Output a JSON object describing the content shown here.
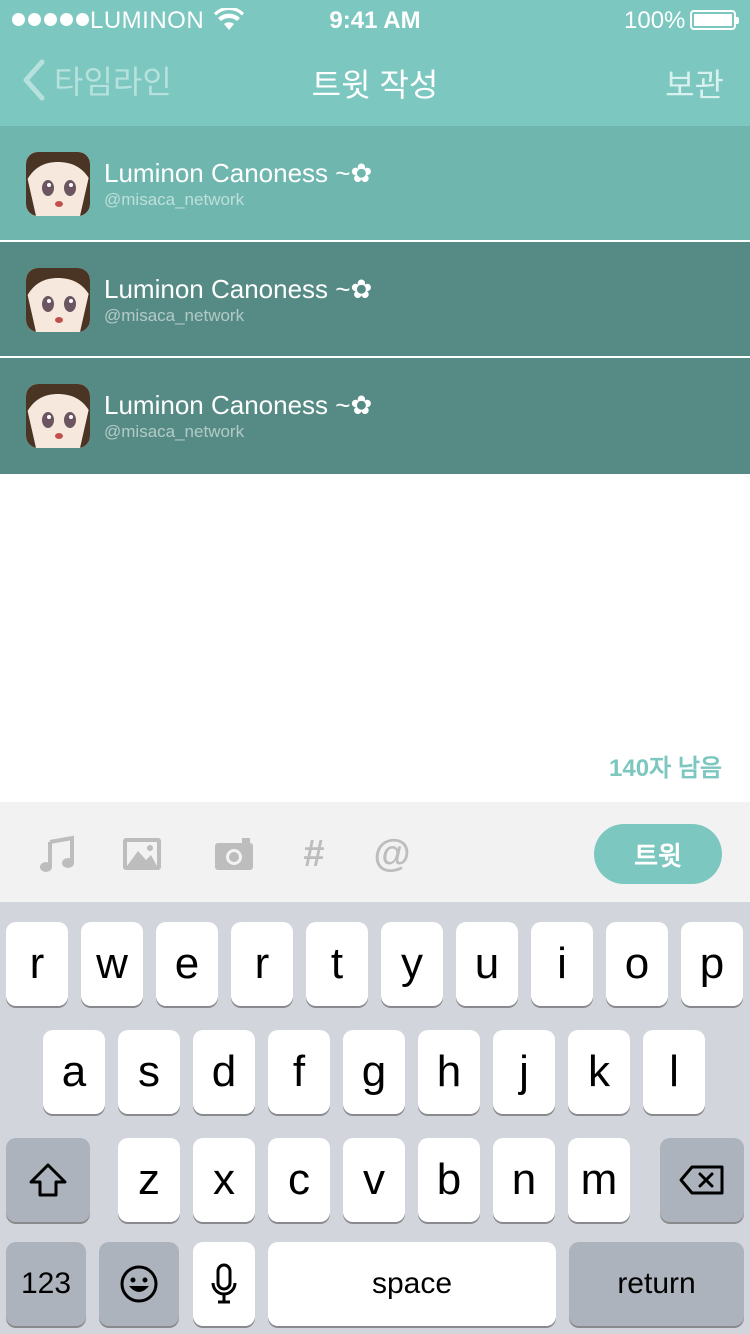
{
  "status_bar": {
    "carrier": "LUMINON",
    "time": "9:41 AM",
    "battery": "100%"
  },
  "nav": {
    "back_label": "타임라인",
    "title": "트윗 작성",
    "save_label": "보관"
  },
  "accounts": [
    {
      "name": "Luminon Canoness ~✿",
      "handle": "@misaca_network",
      "state": "active"
    },
    {
      "name": "Luminon Canoness ~✿",
      "handle": "@misaca_network",
      "state": "inactive"
    },
    {
      "name": "Luminon Canoness ~✿",
      "handle": "@misaca_network",
      "state": "inactive"
    }
  ],
  "compose": {
    "remaining": "140자 남음"
  },
  "toolbar": {
    "icons": [
      "music-icon",
      "image-icon",
      "camera-icon",
      "hashtag-icon",
      "mention-icon"
    ],
    "hashtag": "#",
    "mention": "@",
    "tweet_label": "트윗"
  },
  "keyboard": {
    "row1": [
      "r",
      "w",
      "e",
      "r",
      "t",
      "y",
      "u",
      "i",
      "o",
      "p"
    ],
    "row2": [
      "a",
      "s",
      "d",
      "f",
      "g",
      "h",
      "j",
      "k",
      "l"
    ],
    "row3": [
      "z",
      "x",
      "c",
      "v",
      "b",
      "n",
      "m"
    ],
    "numbers": "123",
    "space": "space",
    "return": "return"
  },
  "colors": {
    "accent": "#7cc7bf",
    "account_active": "#6fb7ae",
    "account_inactive": "#558b84"
  }
}
